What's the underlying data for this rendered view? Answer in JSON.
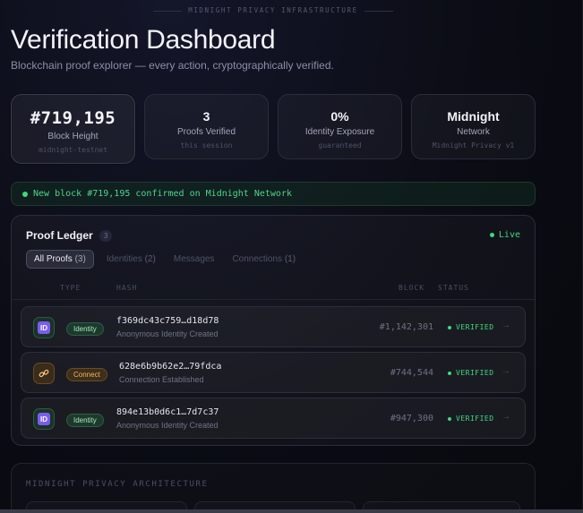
{
  "header": {
    "eyebrow": "MIDNIGHT PRIVACY INFRASTRUCTURE",
    "title": "Verification Dashboard",
    "subtitle": "Blockchain proof explorer — every action, cryptographically verified."
  },
  "stats": [
    {
      "value": "#719,195",
      "label": "Block Height",
      "sub": "midnight-testnet"
    },
    {
      "value": "3",
      "label": "Proofs Verified",
      "sub": "this session"
    },
    {
      "value": "0%",
      "label": "Identity Exposure",
      "sub": "guaranteed"
    },
    {
      "value": "Midnight",
      "label": "Network",
      "sub": "Midnight Privacy v1"
    }
  ],
  "banner": {
    "text": "New block #719,195 confirmed on Midnight Network"
  },
  "ledger": {
    "title": "Proof Ledger",
    "count": "3",
    "live_label": "Live",
    "tabs": [
      {
        "label": "All Proofs",
        "count": "(3)"
      },
      {
        "label": "Identities",
        "count": "(2)"
      },
      {
        "label": "Messages",
        "count": ""
      },
      {
        "label": "Connections",
        "count": "(1)"
      }
    ],
    "columns": {
      "type": "TYPE",
      "hash": "HASH",
      "block": "BLOCK",
      "status": "STATUS"
    },
    "rows": [
      {
        "icon": "id-icon",
        "badge": "Identity",
        "hash": "f369dc43c759…d18d78",
        "desc": "Anonymous Identity Created",
        "block": "#1,142,301",
        "status": "VERIFIED",
        "arrow": "→"
      },
      {
        "icon": "link-icon",
        "badge": "Connect",
        "hash": "628e6b9b62e2…79fdca",
        "desc": "Connection Established",
        "block": "#744,544",
        "status": "VERIFIED",
        "arrow": "→"
      },
      {
        "icon": "id-icon",
        "badge": "Identity",
        "hash": "894e13b0d6c1…7d7c37",
        "desc": "Anonymous Identity Created",
        "block": "#947,300",
        "status": "VERIFIED",
        "arrow": "→"
      }
    ]
  },
  "architecture": {
    "title": "MIDNIGHT PRIVACY ARCHITECTURE"
  },
  "colors": {
    "accent_green": "#3ed97f",
    "identity_purple": "#7b5cf0",
    "connect_orange": "#f0b56a",
    "background": "#0b0c14"
  }
}
